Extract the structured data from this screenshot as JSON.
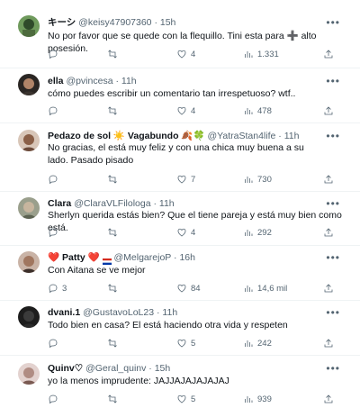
{
  "tweets": [
    {
      "name": "キーシ",
      "handle": "@keisy47907360",
      "time": "15h",
      "text": "No por favor que se quede con la flequillo. Tini esta para ➕ alto posesión.",
      "replies": "",
      "retweets": "",
      "likes": "4",
      "views": "1.331"
    },
    {
      "name": "ella",
      "handle": "@pvincesa",
      "time": "11h",
      "text": "cómo puedes escribir un comentario tan irrespetuoso? wtf..",
      "replies": "",
      "retweets": "",
      "likes": "4",
      "views": "478"
    },
    {
      "name": "Pedazo de sol ☀️ Vagabundo 🍂🍀",
      "handle": "@YatraStan4life",
      "time": "11h",
      "text": "No gracias, el está muy feliz y con una chica muy buena a su lado. Pasado pisado",
      "replies": "",
      "retweets": "",
      "likes": "7",
      "views": "730"
    },
    {
      "name": "Clara",
      "handle": "@ClaraVLFilologa",
      "time": "11h",
      "text": "Sherlyn querida estás bien? Que el tiene pareja y está muy bien como está.",
      "replies": "",
      "retweets": "",
      "likes": "4",
      "views": "292"
    },
    {
      "name": "❤️ Patty ❤️",
      "handle": "@MelgarejoP",
      "time": "16h",
      "text": "Con Aitana se ve mejor",
      "replies": "3",
      "retweets": "",
      "likes": "84",
      "views": "14,6 mil"
    },
    {
      "name": "dvani.1",
      "handle": "@GustavoLoL23",
      "time": "11h",
      "text": "Todo bien en casa? El está haciendo otra vida y respeten",
      "replies": "",
      "retweets": "",
      "likes": "5",
      "views": "242"
    },
    {
      "name": "Quinv♡",
      "handle": "@Geral_quinv",
      "time": "15h",
      "text": "yo la menos imprudente: JAJJAJAJAJAJAJ",
      "replies": "",
      "retweets": "",
      "likes": "5",
      "views": "939"
    }
  ],
  "separator": "·",
  "colors": {
    "text": "#0f1419",
    "secondary": "#536471",
    "border": "#eff3f4"
  },
  "icons": [
    "reply-icon",
    "retweet-icon",
    "like-icon",
    "views-icon",
    "share-icon",
    "more-icon"
  ]
}
